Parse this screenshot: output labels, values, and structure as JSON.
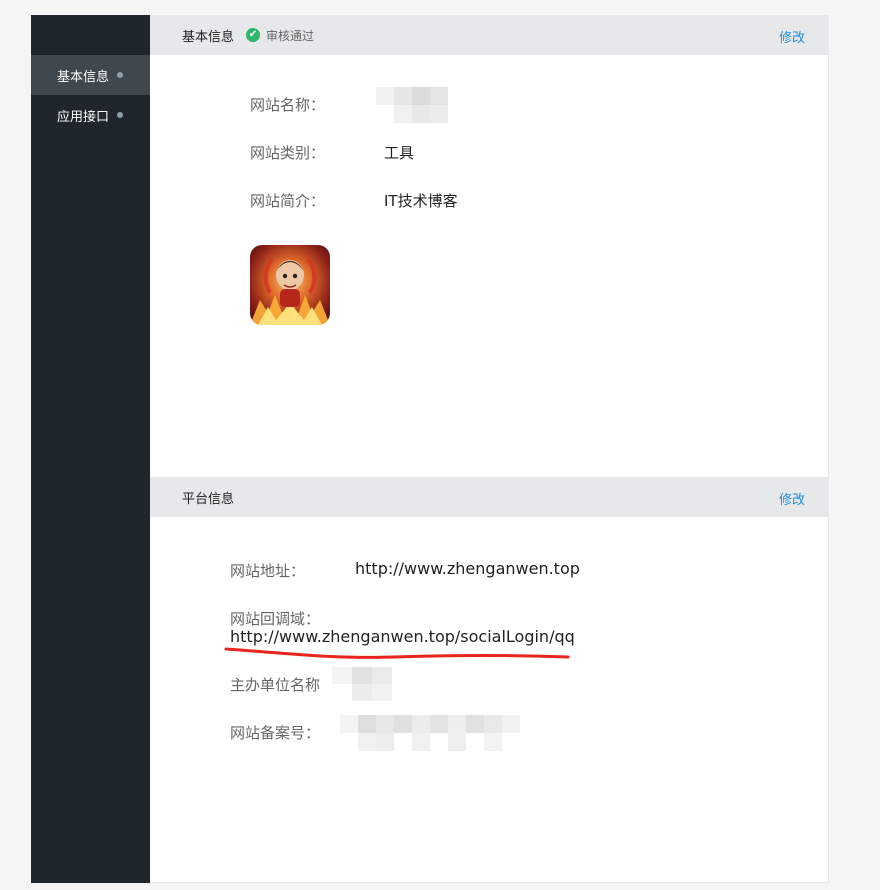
{
  "sidebar": {
    "items": [
      {
        "label": "基本信息",
        "active": true
      },
      {
        "label": "应用接口",
        "active": false
      }
    ]
  },
  "basic": {
    "title": "基本信息",
    "status": "审核通过",
    "edit_label": "修改",
    "fields": {
      "name_label": "网站名称：",
      "category_label": "网站类别：",
      "category_value": "工具",
      "intro_label": "网站简介：",
      "intro_value": "IT技术博客"
    }
  },
  "platform": {
    "title": "平台信息",
    "edit_label": "修改",
    "fields": {
      "address_label": "网站地址：",
      "address_value": "http://www.zhenganwen.top",
      "callback_label": "网站回调域：",
      "callback_value": "http://www.zhenganwen.top/socialLogin/qq",
      "org_label": "主办单位名称",
      "icp_label": "网站备案号："
    }
  },
  "colors": {
    "sidebar_bg": "#1f262e",
    "active_item": "#3f474f",
    "link": "#1f8fe0",
    "status_ok": "#2fb56e",
    "annotation": "#e8261e"
  }
}
